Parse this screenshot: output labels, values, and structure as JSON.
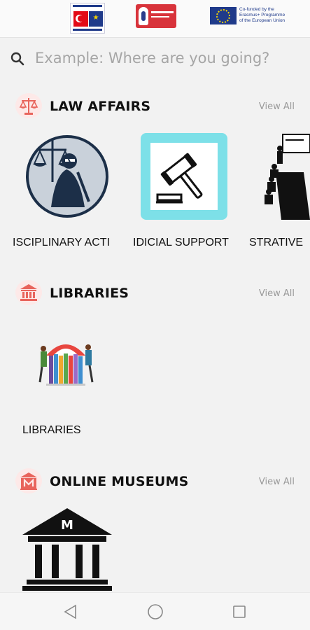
{
  "header": {
    "eu_logo_text": [
      "Co-funded by the",
      "Erasmus+ Programme",
      "of the European Union"
    ]
  },
  "search": {
    "placeholder": "Example: Where are you going?"
  },
  "sections": [
    {
      "title": "LAW AFFAIRS",
      "view_all": "View All",
      "icon": "scales-icon",
      "items": [
        {
          "label": "DISCIPLINARY ACTIONS",
          "visible_label": "ISCIPLINARY ACTI",
          "image": "lady-justice-image"
        },
        {
          "label": "JUDICIAL SUPPORT",
          "visible_label": "IDICIAL SUPPORT",
          "image": "gavel-image"
        },
        {
          "label": "ADMINISTRATIVE",
          "visible_label": "STRATIVE",
          "image": "meeting-room-image"
        }
      ]
    },
    {
      "title": "LIBRARIES",
      "view_all": "View All",
      "icon": "library-building-icon",
      "items": [
        {
          "label": "LIBRARIES",
          "visible_label": "LIBRARIES",
          "image": "books-people-image"
        }
      ]
    },
    {
      "title": "ONLINE MUSEUMS",
      "view_all": "View All",
      "icon": "museum-icon",
      "items": [
        {
          "label": "MUSEUM",
          "visible_label": "",
          "image": "museum-building-image"
        }
      ]
    }
  ],
  "colors": {
    "accent": "#e8645c",
    "accent_bg": "#fde9e8",
    "gavel_frame": "#7de0e8",
    "text": "#111111",
    "muted": "#9a9a9a"
  },
  "navbar": {
    "buttons": [
      "back-icon",
      "home-icon",
      "recents-icon"
    ]
  }
}
